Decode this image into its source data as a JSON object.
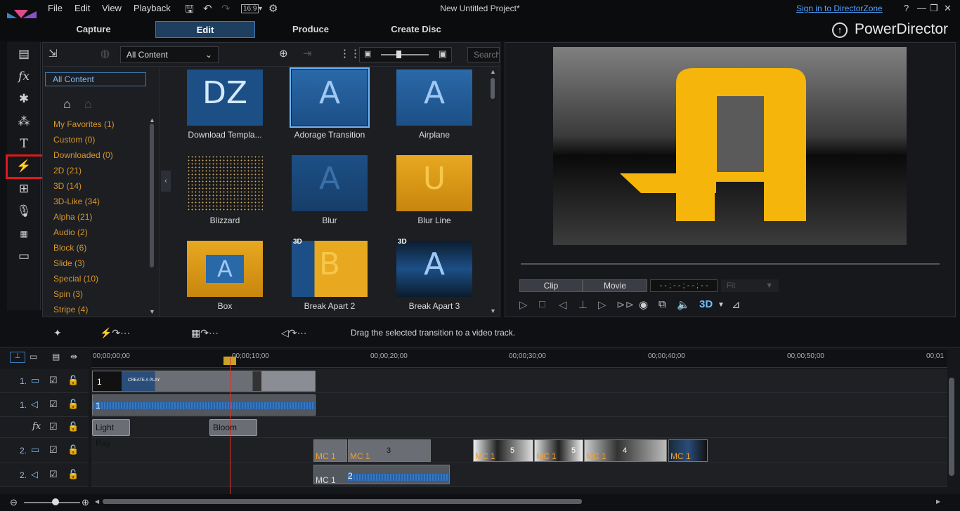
{
  "menu": {
    "file": "File",
    "edit": "Edit",
    "view": "View",
    "playback": "Playback",
    "aspect": "16:9"
  },
  "window": {
    "title": "New Untitled Project*",
    "signin": "Sign in to DirectorZone",
    "help": "?"
  },
  "modes": {
    "capture": "Capture",
    "edit": "Edit",
    "produce": "Produce",
    "create_disc": "Create Disc"
  },
  "brand": "PowerDirector",
  "library": {
    "filter": "All Content",
    "search_placeholder": "Search tl",
    "selected_category": "All Content",
    "categories": [
      "My Favorites  (1)",
      "Custom  (0)",
      "Downloaded  (0)",
      "2D  (21)",
      "3D  (14)",
      "3D-Like  (34)",
      "Alpha  (21)",
      "Audio  (2)",
      "Block  (6)",
      "Slide  (3)",
      "Special  (10)",
      "Spin  (3)",
      "Stripe  (4)"
    ],
    "thumbs": [
      {
        "label": "Download Templa...",
        "glyph": "DZ"
      },
      {
        "label": "Adorage Transition",
        "glyph": "A"
      },
      {
        "label": "Airplane",
        "glyph": "A"
      },
      {
        "label": "Blizzard",
        "glyph": ""
      },
      {
        "label": "Blur",
        "glyph": "A"
      },
      {
        "label": "Blur Line",
        "glyph": "U"
      },
      {
        "label": "Box",
        "glyph": "A"
      },
      {
        "label": "Break Apart 2",
        "glyph": "B",
        "badge": "3D"
      },
      {
        "label": "Break Apart 3",
        "glyph": "A",
        "badge": "3D"
      }
    ]
  },
  "preview": {
    "glyph": "A",
    "clip": "Clip",
    "movie": "Movie",
    "timecode": "- - ; - - ; - - ; - -",
    "fit": "Fit",
    "threed": "3D"
  },
  "hint": "Drag the selected transition to a video track.",
  "ruler": [
    "00;00;00;00",
    "00;00;10;00",
    "00;00;20;00",
    "00;00;30;00",
    "00;00;40;00",
    "00;00;50;00",
    "00;01"
  ],
  "tracks": {
    "v1": "1.",
    "a1": "1.",
    "fx": "fx",
    "v2": "2.",
    "a2": "2.",
    "clip1_num": "1",
    "clip1_text": "CREATE A PLAY",
    "audio1_num": "1",
    "fx1": "Light Ray",
    "fx2": "Bloom",
    "mc": "MC 1",
    "v2_nums": [
      "3",
      "5",
      "5",
      "4"
    ],
    "audio2_num": "2"
  }
}
